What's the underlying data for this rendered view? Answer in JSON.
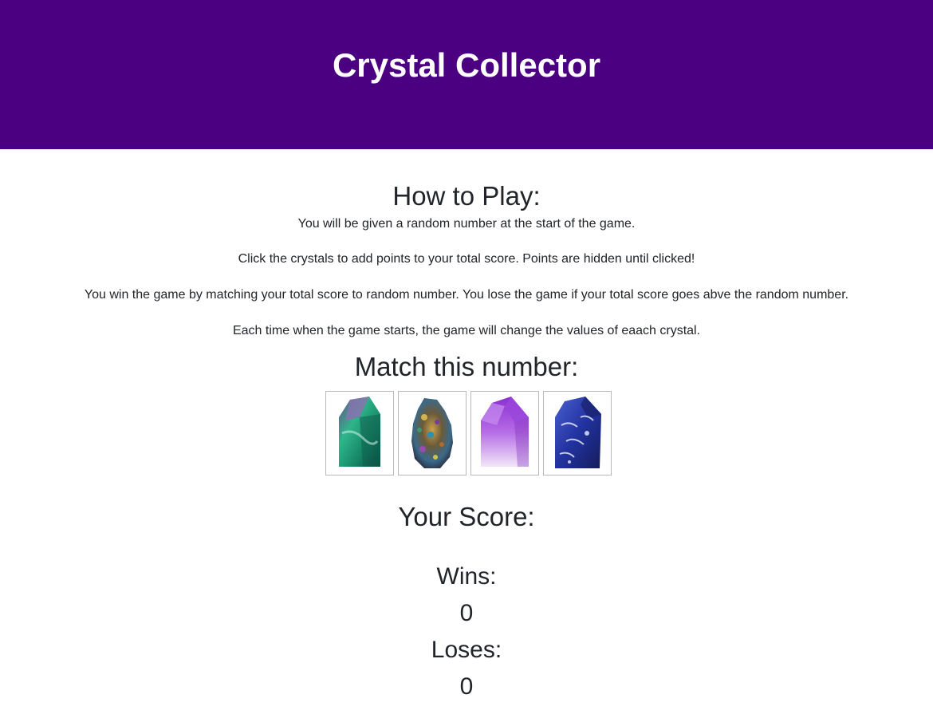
{
  "header": {
    "title": "Crystal Collector"
  },
  "howto": {
    "title": "How to Play:",
    "lines": [
      "You will be given a random number at the start of the game.",
      "Click the crystals to add points to your total score. Points are hidden until clicked!",
      "You win the game by matching your total score to random number. You lose the game if your total score goes abve the random number.",
      "Each time when the game starts, the game will change the values of eaach crystal."
    ]
  },
  "match": {
    "title": "Match this number:"
  },
  "crystals": [
    {
      "name": "green-fluorite-crystal",
      "color": "#1f9a6e"
    },
    {
      "name": "rainbow-aura-crystal",
      "color": "#8a6a2e"
    },
    {
      "name": "amethyst-crystal",
      "color": "#a64fd6"
    },
    {
      "name": "sodalite-crystal",
      "color": "#2b3fa3"
    }
  ],
  "score": {
    "title": "Your Score:",
    "wins_label": "Wins:",
    "wins_value": "0",
    "loses_label": "Loses:",
    "loses_value": "0"
  },
  "colors": {
    "header_bg": "#4b0082",
    "header_text": "#ffffff"
  }
}
